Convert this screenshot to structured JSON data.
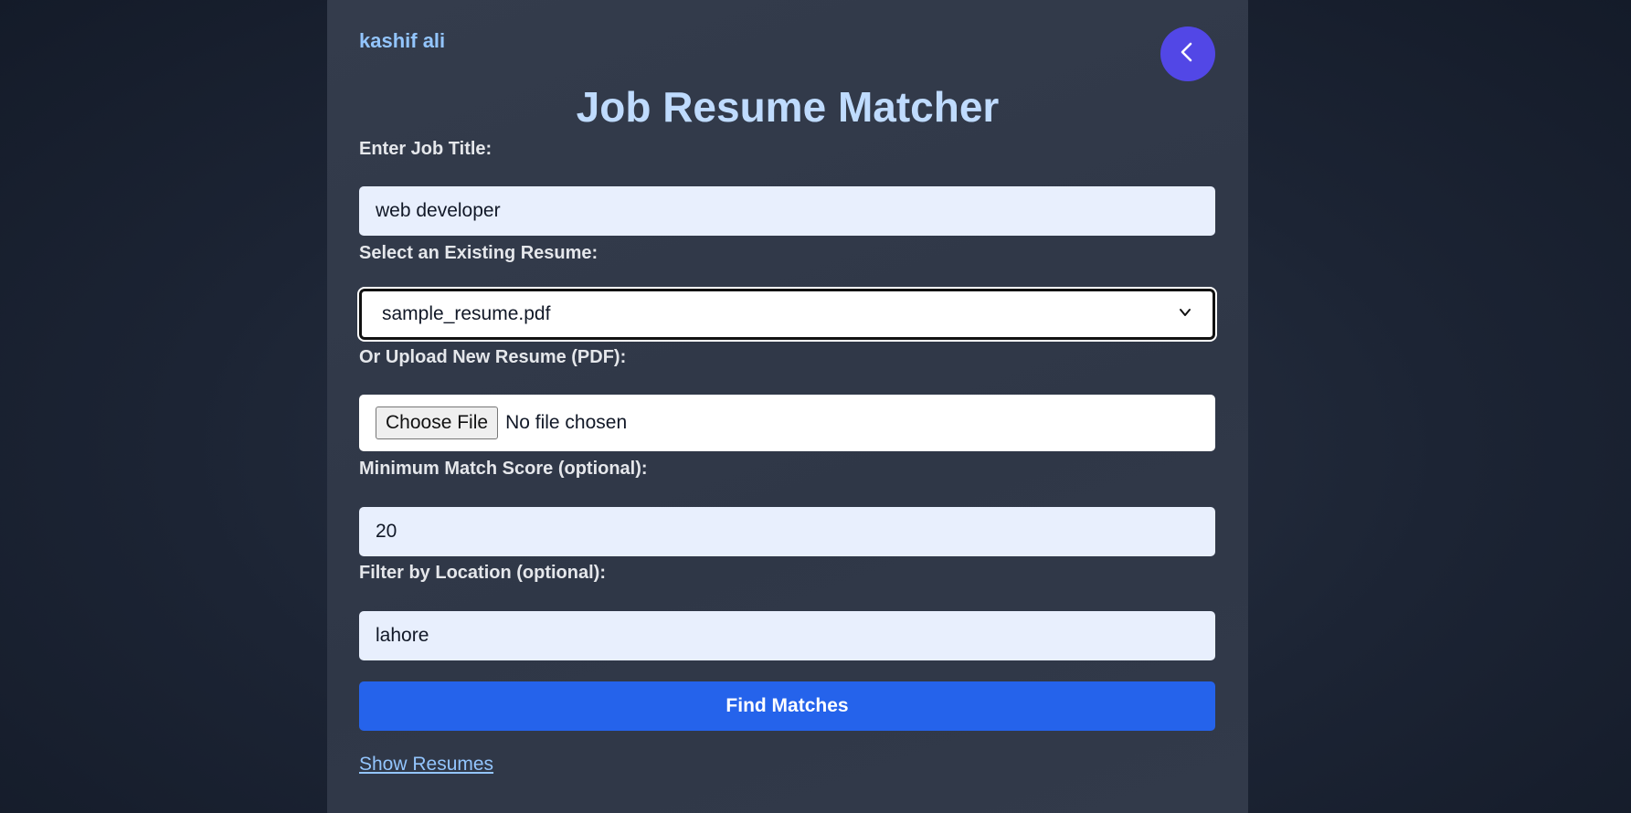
{
  "header": {
    "username": "kashif ali",
    "title": "Job Resume Matcher",
    "back_icon": "chevron-left-icon"
  },
  "form": {
    "job_title": {
      "label": "Enter Job Title:",
      "value": "web developer"
    },
    "existing_resume": {
      "label": "Select an Existing Resume:",
      "selected": "sample_resume.pdf"
    },
    "upload": {
      "label": "Or Upload New Resume (PDF):",
      "button": "Choose File",
      "status": "No file chosen"
    },
    "min_score": {
      "label": "Minimum Match Score (optional):",
      "value": "20"
    },
    "location": {
      "label": "Filter by Location (optional):",
      "value": "lahore"
    },
    "submit": "Find Matches",
    "show_resumes": "Show Resumes"
  },
  "colors": {
    "accent_purple": "#5247e6",
    "primary_button": "#2563eb",
    "title": "#bfdbfe",
    "link": "#93c5fd"
  }
}
